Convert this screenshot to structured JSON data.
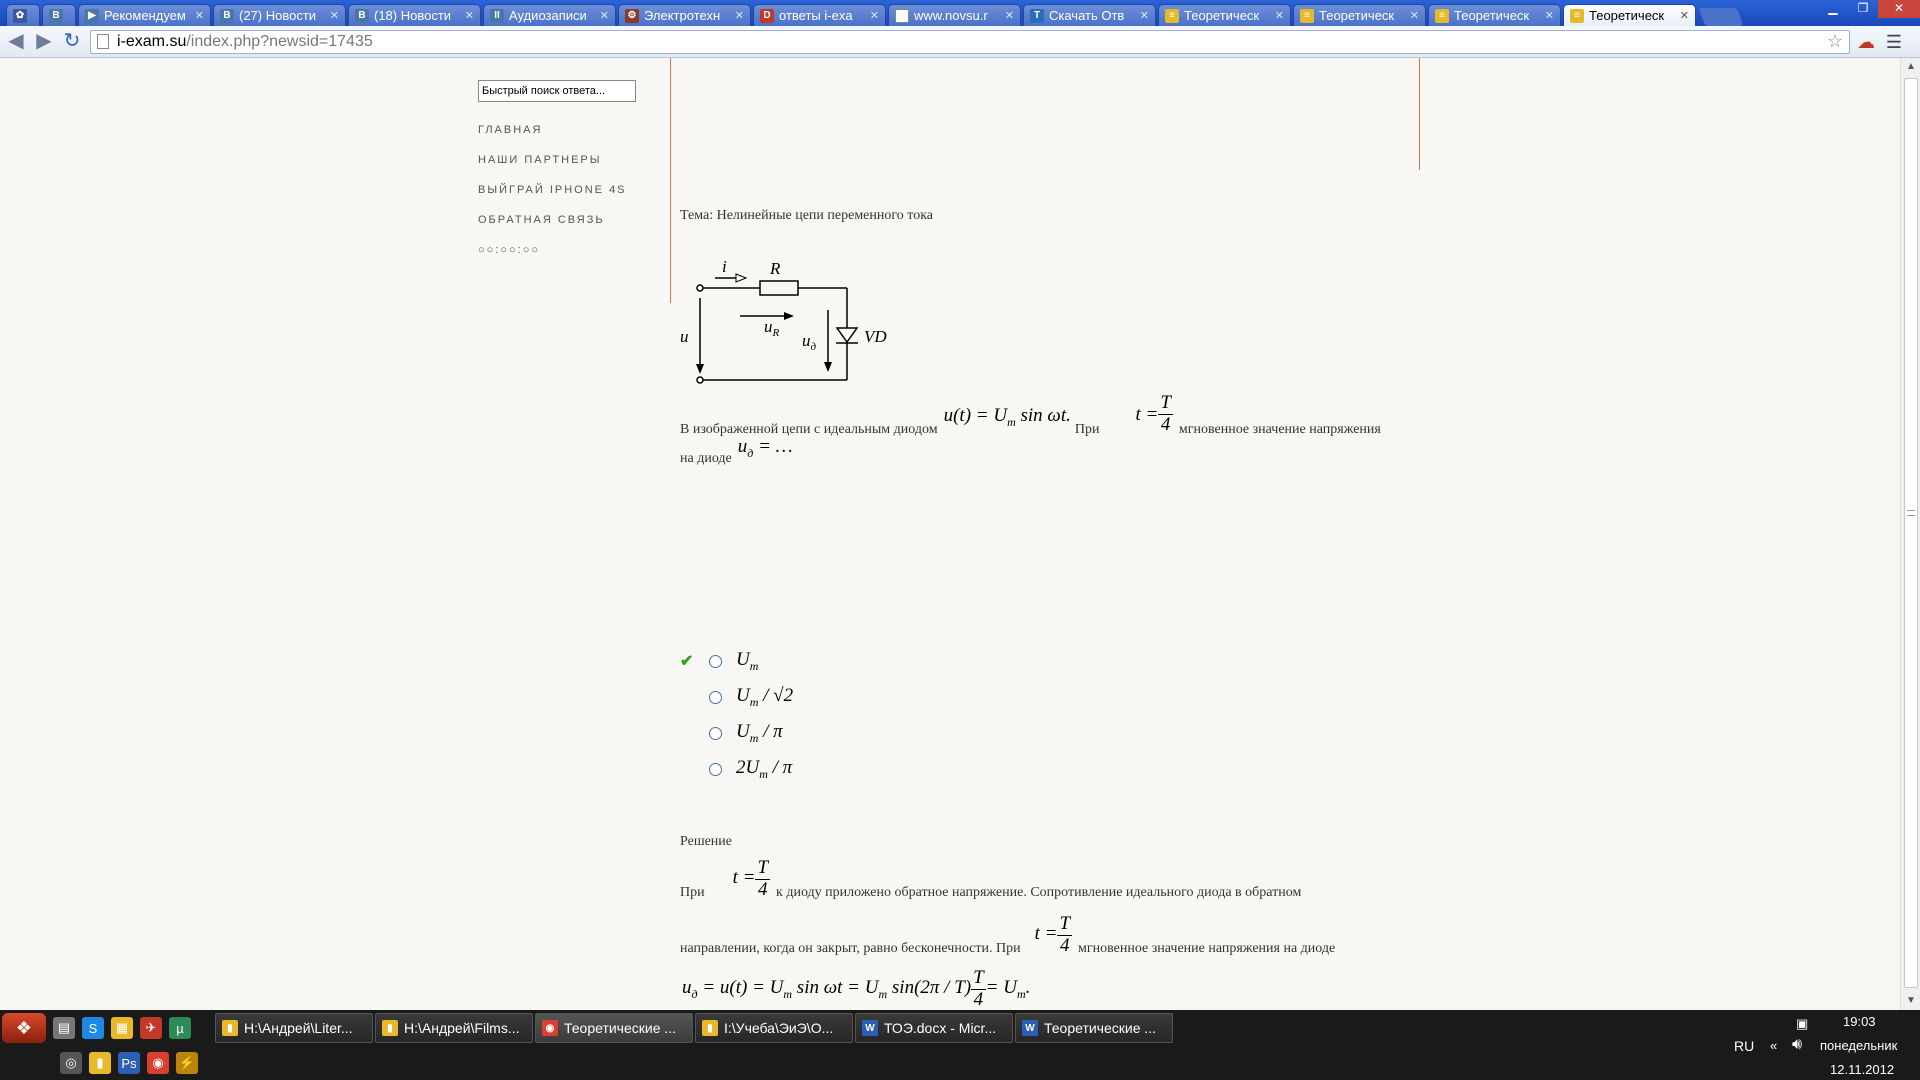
{
  "browser": {
    "tabs": [
      {
        "label": "",
        "icon": "app-icon",
        "color": "#3b5998",
        "glyph": "✿"
      },
      {
        "label": "",
        "icon": "vk-icon",
        "color": "#4a76a8",
        "glyph": "B"
      },
      {
        "label": "Рекомендуем",
        "icon": "video-icon",
        "color": "#4a76a8",
        "glyph": "▶"
      },
      {
        "label": "(27) Новости",
        "icon": "vk-icon",
        "color": "#4a76a8",
        "glyph": "B"
      },
      {
        "label": "(18) Новости",
        "icon": "vk-icon",
        "color": "#4a76a8",
        "glyph": "B"
      },
      {
        "label": "Аудиозаписи",
        "icon": "audio-icon",
        "color": "#4a76a8",
        "glyph": "II"
      },
      {
        "label": "Электротехн",
        "icon": "gear-icon",
        "color": "#8a3a2a",
        "glyph": "⚙"
      },
      {
        "label": "ответы i-exa",
        "icon": "pdf-icon",
        "color": "#c0392b",
        "glyph": "D"
      },
      {
        "label": "www.novsu.r",
        "icon": "page-icon",
        "color": "#ffffff",
        "glyph": ""
      },
      {
        "label": "Скачать Отв",
        "icon": "t-icon",
        "color": "#2a6fb5",
        "glyph": "T"
      },
      {
        "label": "Теоретическ",
        "icon": "iexam-icon",
        "color": "#e7b928",
        "glyph": "≡"
      },
      {
        "label": "Теоретическ",
        "icon": "iexam-icon",
        "color": "#e7b928",
        "glyph": "≡"
      },
      {
        "label": "Теоретическ",
        "icon": "iexam-icon",
        "color": "#e7b928",
        "glyph": "≡"
      },
      {
        "label": "Теоретическ",
        "icon": "iexam-icon",
        "color": "#e7b928",
        "glyph": "≡",
        "active": true
      }
    ],
    "url_host": "i-exam.su",
    "url_path": "/index.php?newsid=17435"
  },
  "sidebar": {
    "search_placeholder": "Быстрый поиск ответа...",
    "links": [
      "ГЛАВНАЯ",
      "НАШИ ПАРТНЕРЫ",
      "ВЫЙГРАЙ IPHONE 4S",
      "ОБРАТНАЯ СВЯЗЬ",
      "○○:○○:○○"
    ]
  },
  "content": {
    "topic": "Тема: Нелинейные цепи переменного тока",
    "circuit": {
      "i": "i",
      "R": "R",
      "uR": "u",
      "uR_sub": "R",
      "u": "u",
      "ud": "u",
      "ud_sub": "д",
      "VD": "VD"
    },
    "question": {
      "text1": "В изображенной цепи с идеальным диодом",
      "formula1": "u(t) = U",
      "formula1_sub": "m",
      "formula1_tail": " sin ωt.",
      "text2": "При",
      "t_eq": "t =",
      "T": "T",
      "four": "4",
      "text3": "мгновенное значение напряжения",
      "text4": "на диоде",
      "ud": "u",
      "ud_sub": "д",
      "ud_tail": " = …"
    },
    "options": [
      {
        "main": "U",
        "sub": "m",
        "tail": "",
        "correct": true
      },
      {
        "main": "U",
        "sub": "m",
        "tail": " / √2",
        "correct": false
      },
      {
        "main": "U",
        "sub": "m",
        "tail": " / π",
        "correct": false
      },
      {
        "main": "2U",
        "sub": "m",
        "tail": " / π",
        "correct": false
      }
    ],
    "solution": {
      "title": "Решение",
      "p1a": "При",
      "p1b": "к диоду приложено обратное напряжение. Сопротивление идеального диода в обратном",
      "p2a": "направлении, когда он закрыт, равно бесконечности. При",
      "p2b": "мгновенное значение напряжения на диоде",
      "final": "u",
      "final_sub": "д",
      "final_mid1": " = u(t) = U",
      "final_mid2": " sin ωt = U",
      "final_mid3": " sin(2π / T)",
      "final_tail": " = U",
      "m": "m",
      "end": "."
    }
  },
  "taskbar": {
    "items": [
      {
        "label": "H:\\Андрей\\Liter...",
        "icon": "folder-icon",
        "color": "#e7b928",
        "glyph": "▮"
      },
      {
        "label": "H:\\Андрей\\Films...",
        "icon": "folder-icon",
        "color": "#e7b928",
        "glyph": "▮"
      },
      {
        "label": "Теоретические ...",
        "icon": "chrome-icon",
        "color": "#d94030",
        "glyph": "◉",
        "active": true
      },
      {
        "label": "I:\\Учеба\\ЭиЭ\\О...",
        "icon": "folder-icon",
        "color": "#e7b928",
        "glyph": "▮"
      },
      {
        "label": "ТОЭ.docx - Micr...",
        "icon": "word-icon",
        "color": "#2b5fb4",
        "glyph": "W"
      },
      {
        "label": "Теоретические ...",
        "icon": "word-icon",
        "color": "#2b5fb4",
        "glyph": "W"
      }
    ],
    "lang": "RU",
    "time": "19:03",
    "day": "понедельник",
    "date": "12.11.2012"
  }
}
